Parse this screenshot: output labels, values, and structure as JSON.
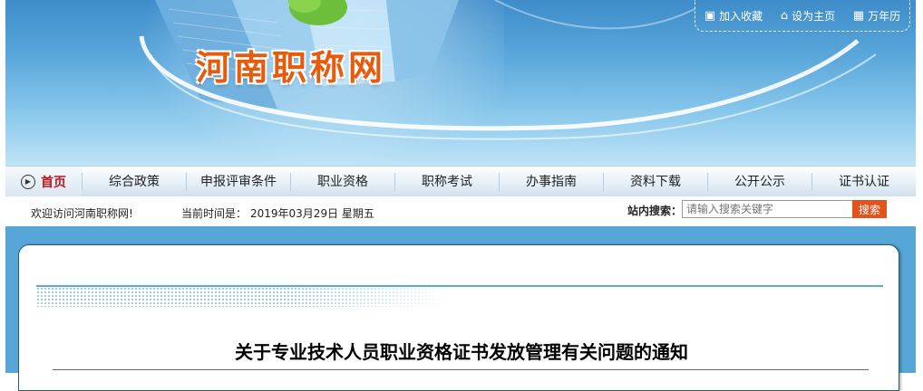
{
  "site": {
    "title": "河南职称网"
  },
  "quick_links": [
    {
      "label": "加入收藏",
      "icon": "bookmark-icon"
    },
    {
      "label": "设为主页",
      "icon": "home-page-icon"
    },
    {
      "label": "万年历",
      "icon": "calendar-icon"
    }
  ],
  "nav": {
    "home_label": "首页",
    "items": [
      "综合政策",
      "申报评审条件",
      "职业资格",
      "职称考试",
      "办事指南",
      "资料下载",
      "公开公示",
      "证书认证"
    ]
  },
  "infobar": {
    "welcome": "欢迎访问河南职称网!",
    "time_label": "当前时间是：",
    "time_value": "2019年03月29日 星期五",
    "search_label": "站内搜索：",
    "search_placeholder": "请输入搜索关键字",
    "search_button": "搜索"
  },
  "article": {
    "title": "关于专业技术人员职业资格证书发放管理有关问题的通知"
  },
  "colors": {
    "title_orange": "#e85a0c",
    "home_red": "#c0141b",
    "search_button": "#e2521c",
    "banner_blue": "#5ba8dc"
  }
}
